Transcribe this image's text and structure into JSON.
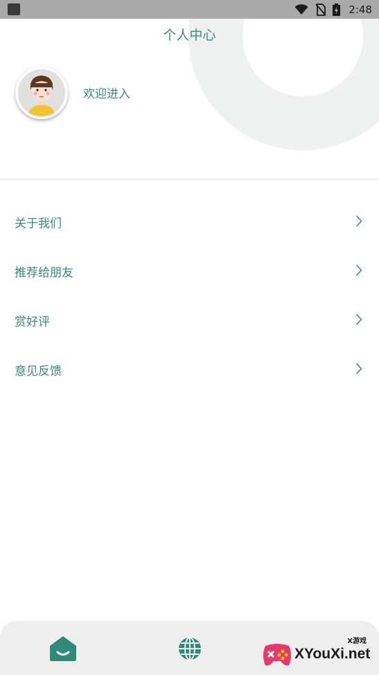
{
  "status_bar": {
    "time": "2:48",
    "icons": [
      "wifi-icon",
      "no-sim-icon",
      "battery-charging-icon"
    ]
  },
  "header": {
    "title": "个人中心",
    "welcome": "欢迎进入",
    "avatar": "avatar-cartoon-girl"
  },
  "menu": {
    "items": [
      {
        "label": "关于我们",
        "icon": "chevron-right-icon"
      },
      {
        "label": "推荐给朋友",
        "icon": "chevron-right-icon"
      },
      {
        "label": "赏好评",
        "icon": "chevron-right-icon"
      },
      {
        "label": "意见反馈",
        "icon": "chevron-right-icon"
      }
    ]
  },
  "bottom_nav": {
    "tabs": [
      {
        "icon": "home-icon"
      },
      {
        "icon": "globe-icon"
      }
    ]
  },
  "watermark": {
    "small": "X游戏",
    "text": "XYouXi.net"
  },
  "colors": {
    "accent": "#3b8a7d",
    "status_bar": "#a9a9a9",
    "ring": "#eff1f1",
    "bottom_bar": "#eeeeee"
  }
}
